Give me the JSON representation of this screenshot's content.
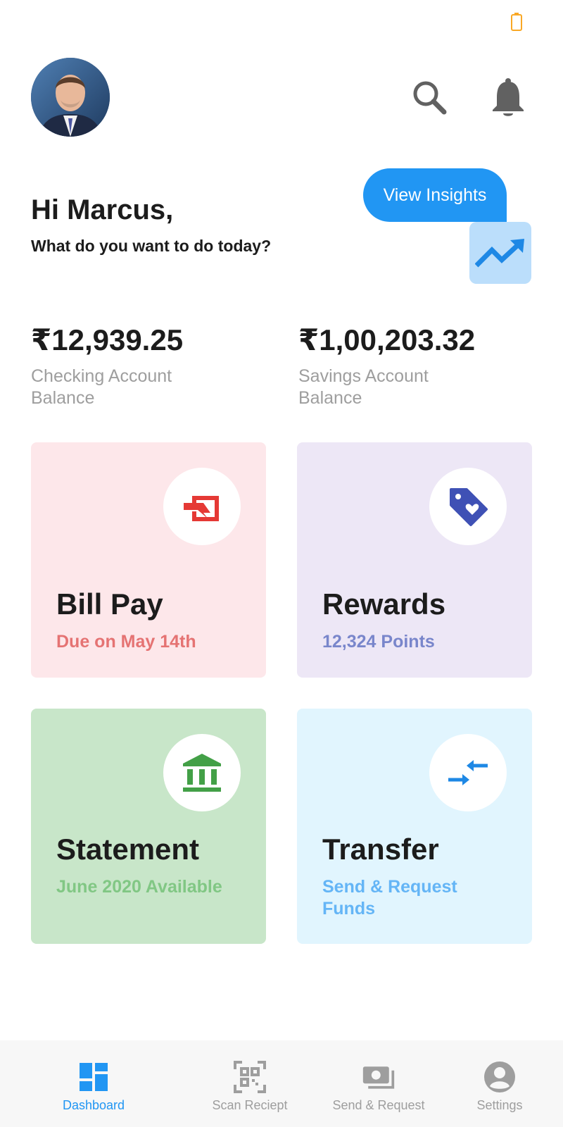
{
  "status_bar": {
    "battery_icon": "battery-icon"
  },
  "header": {
    "avatar_alt": "Marcus profile photo",
    "search_icon": "search-icon",
    "bell_icon": "bell-icon"
  },
  "greeting": {
    "title": "Hi Marcus,",
    "subtitle": "What do you want to do today?"
  },
  "insights": {
    "label": "View Insights",
    "icon": "trending-up-icon"
  },
  "balances": [
    {
      "amount": "₹12,939.25",
      "label": "Checking Account Balance"
    },
    {
      "amount": "₹1,00,203.32",
      "label": "Savings Account Balance"
    }
  ],
  "cards": [
    {
      "title": "Bill Pay",
      "subtitle": "Due on May 14th",
      "icon": "bill-icon",
      "bg": "#fde7ea",
      "accent": "#e57373"
    },
    {
      "title": "Rewards",
      "subtitle": "12,324 Points",
      "icon": "tag-heart-icon",
      "bg": "#ede7f6",
      "accent": "#7986cb"
    },
    {
      "title": "Statement",
      "subtitle": "June 2020 Available",
      "icon": "bank-icon",
      "bg": "#c8e6c9",
      "accent": "#81c784"
    },
    {
      "title": "Transfer",
      "subtitle": "Send & Request Funds",
      "icon": "transfer-arrows-icon",
      "bg": "#e1f5fe",
      "accent": "#64b5f6"
    }
  ],
  "nav": [
    {
      "label": "Dashboard",
      "icon": "dashboard-icon",
      "active": true
    },
    {
      "label": "Scan Reciept",
      "icon": "qr-scan-icon",
      "active": false
    },
    {
      "label": "Send & Request",
      "icon": "money-icon",
      "active": false
    },
    {
      "label": "Settings",
      "icon": "account-circle-icon",
      "active": false
    }
  ],
  "colors": {
    "accent": "#2196f3",
    "nav_active": "#2196f3",
    "nav_inactive": "#9e9e9e"
  }
}
